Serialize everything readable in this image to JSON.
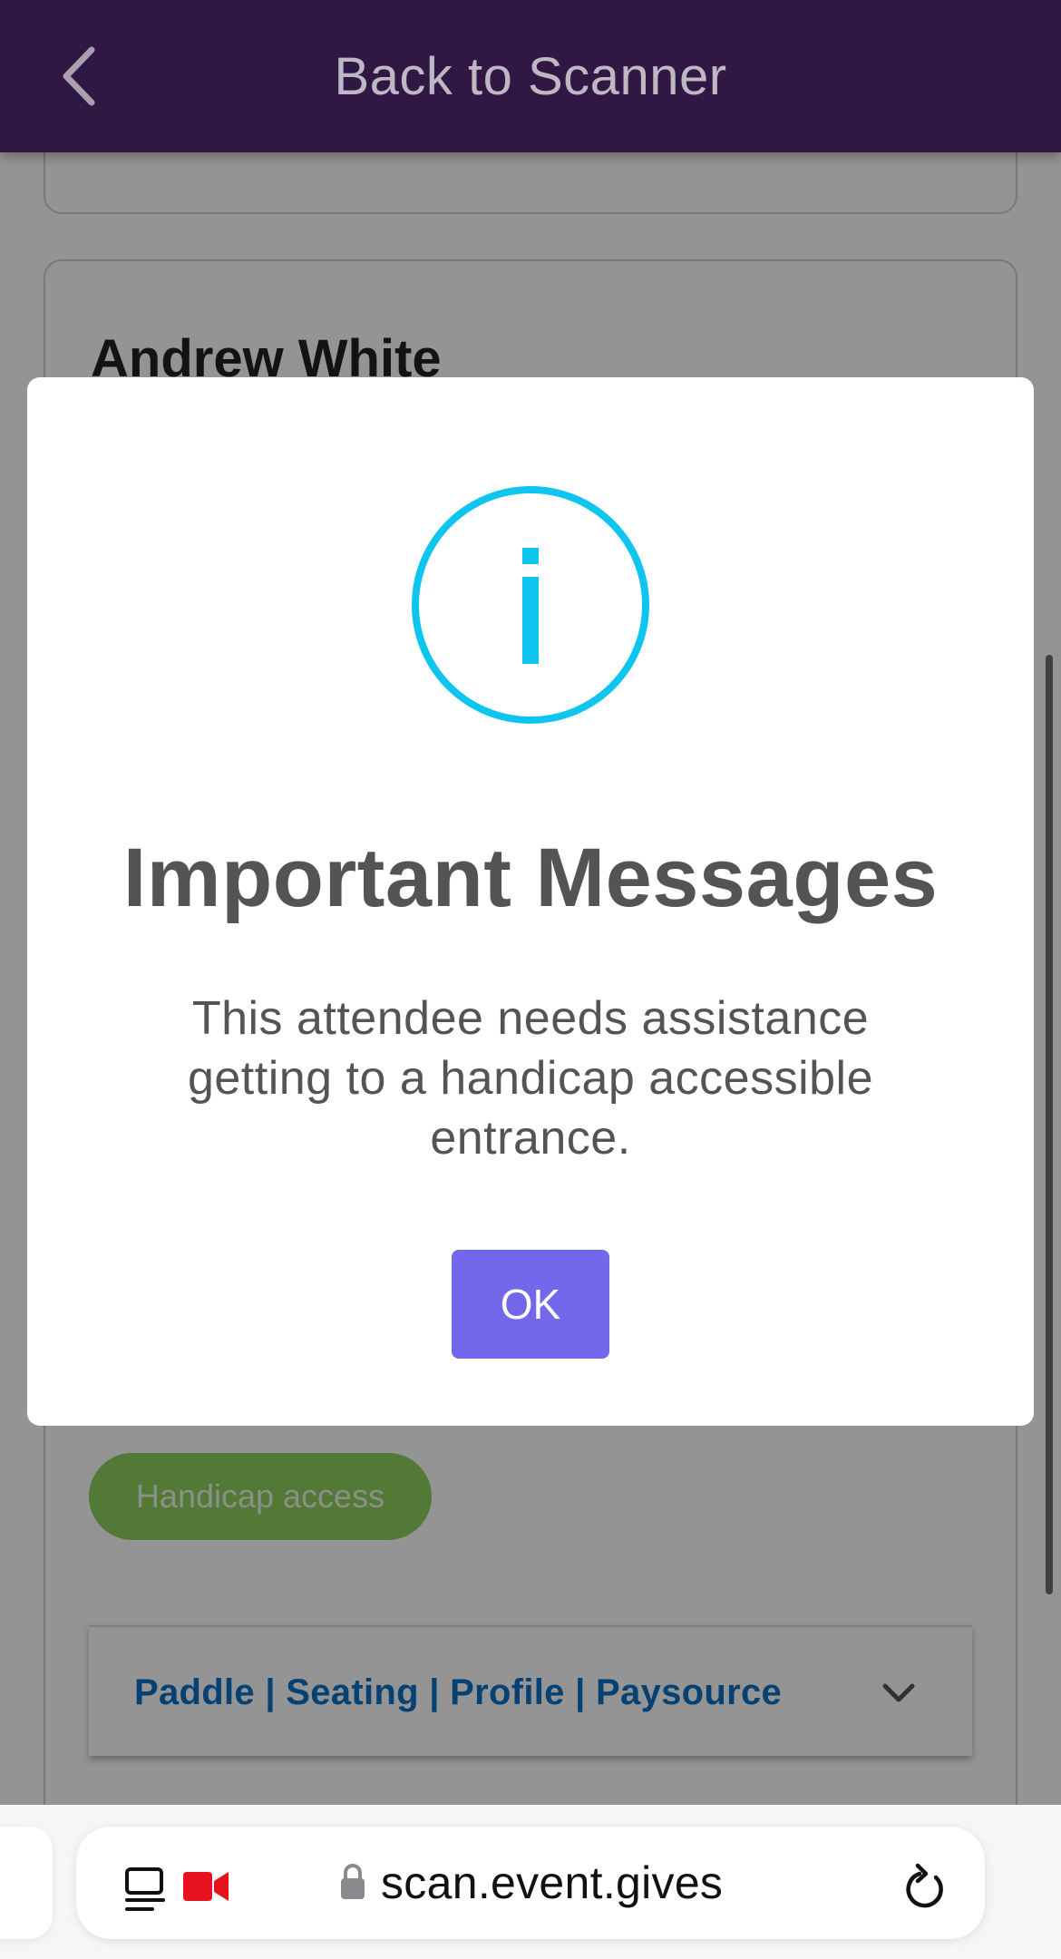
{
  "header": {
    "back_icon": "chevron-left-icon",
    "title": "Back to Scanner"
  },
  "attendee": {
    "name": "Andrew White",
    "tag": "Handicap access",
    "tabs_label": "Paddle | Seating | Profile | Paysource",
    "tabs_icon": "chevron-down-icon"
  },
  "modal": {
    "icon": "info-icon",
    "title": "Important Messages",
    "message": "This attendee needs assistance getting to a handicap accessible entrance.",
    "ok_label": "OK"
  },
  "browser": {
    "url": "scan.event.gives",
    "icons": [
      "tab-overview-icon",
      "camera-recording-icon",
      "lock-icon",
      "reload-icon"
    ]
  },
  "colors": {
    "header_bg": "#301744",
    "info_accent": "#0ec5ef",
    "ok_button": "#7367ec",
    "tag_green": "#8fd160",
    "link_blue": "#0a72c6",
    "recording_red": "#e8121f"
  }
}
